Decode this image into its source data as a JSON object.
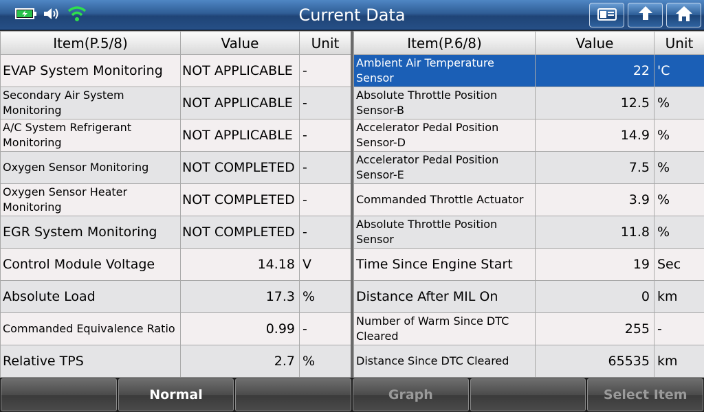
{
  "header": {
    "title": "Current Data",
    "status_icons": [
      "battery-charging-icon",
      "speaker-icon",
      "wifi-icon"
    ],
    "buttons": [
      "screenshot-icon",
      "back-icon",
      "home-icon"
    ]
  },
  "left_table": {
    "headers": {
      "item": "Item(P.5/8)",
      "value": "Value",
      "unit": "Unit"
    },
    "rows": [
      {
        "item": "EVAP System Monitoring",
        "value": "NOT APPLICABLE",
        "unit": "-"
      },
      {
        "item": "Secondary Air System Monitoring",
        "value": "NOT APPLICABLE",
        "unit": "-"
      },
      {
        "item": "A/C System Refrigerant Monitoring",
        "value": "NOT APPLICABLE",
        "unit": "-"
      },
      {
        "item": "Oxygen Sensor Monitoring",
        "value": "NOT COMPLETED",
        "unit": "-"
      },
      {
        "item": "Oxygen Sensor Heater Monitoring",
        "value": "NOT COMPLETED",
        "unit": "-"
      },
      {
        "item": "EGR System Monitoring",
        "value": "NOT COMPLETED",
        "unit": "-"
      },
      {
        "item": "Control Module Voltage",
        "value": "14.18",
        "unit": "V"
      },
      {
        "item": "Absolute Load",
        "value": "17.3",
        "unit": "%"
      },
      {
        "item": "Commanded Equivalence Ratio",
        "value": "0.99",
        "unit": "-"
      },
      {
        "item": "Relative TPS",
        "value": "2.7",
        "unit": "%"
      }
    ]
  },
  "right_table": {
    "headers": {
      "item": "Item(P.6/8)",
      "value": "Value",
      "unit": "Unit"
    },
    "rows": [
      {
        "item": "Ambient Air Temperature Sensor",
        "value": "22",
        "unit": "'C"
      },
      {
        "item": "Absolute Throttle Position Sensor-B",
        "value": "12.5",
        "unit": "%"
      },
      {
        "item": "Accelerator Pedal Position Sensor-D",
        "value": "14.9",
        "unit": "%"
      },
      {
        "item": "Accelerator Pedal Position Sensor-E",
        "value": "7.5",
        "unit": "%"
      },
      {
        "item": "Commanded Throttle Actuator",
        "value": "3.9",
        "unit": "%"
      },
      {
        "item": "Absolute Throttle Position Sensor",
        "value": "11.8",
        "unit": "%"
      },
      {
        "item": "Time Since Engine Start",
        "value": "19",
        "unit": "Sec"
      },
      {
        "item": "Distance After MIL On",
        "value": "0",
        "unit": "km"
      },
      {
        "item": "Number of Warm Since DTC Cleared",
        "value": "255",
        "unit": "-"
      },
      {
        "item": "Distance Since DTC Cleared",
        "value": "65535",
        "unit": "km"
      }
    ]
  },
  "footer": {
    "buttons": [
      "",
      "Normal",
      "",
      "Graph",
      "",
      "Select Item"
    ]
  },
  "colors": {
    "header": "#2f5d95",
    "selected_row": "#1b5fb6",
    "footer_button": "#4b4b4b"
  }
}
